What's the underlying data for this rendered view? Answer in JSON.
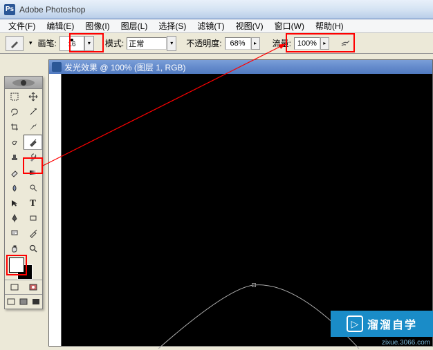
{
  "app": {
    "title": "Adobe Photoshop"
  },
  "menu": [
    "文件(F)",
    "编辑(E)",
    "图像(I)",
    "图层(L)",
    "选择(S)",
    "滤镜(T)",
    "视图(V)",
    "窗口(W)",
    "帮助(H)"
  ],
  "options": {
    "brush_label": "画笔:",
    "brush_size": "16",
    "mode_label": "模式:",
    "mode_value": "正常",
    "opacity_label": "不透明度:",
    "opacity_value": "68%",
    "flow_label": "流量:",
    "flow_value": "100%"
  },
  "document": {
    "title": "发光效果 @ 100% (图层 1, RGB)"
  },
  "toolbox_icons": {
    "marquee": "⬚",
    "move": "✥",
    "lasso": "⌇",
    "wand": "✦",
    "crop": "✂",
    "slice": "⟋",
    "healing": "✚",
    "brush": "✎",
    "stamp": "⊡",
    "history": "↶",
    "eraser": "◫",
    "gradient": "▦",
    "blur": "◉",
    "dodge": "☼",
    "path_sel": "↖",
    "type": "T",
    "pen": "✒",
    "shape": "▭",
    "notes": "✉",
    "eyedrop": "✐",
    "hand": "✋",
    "zoom": "🔍"
  },
  "colors": {
    "fg": "#ffffff",
    "bg": "#000000",
    "highlight": "#ff0000",
    "watermark_bg": "#1a8cc8"
  },
  "watermark": {
    "text": "溜溜自学",
    "url": "zixue.3066.com"
  }
}
